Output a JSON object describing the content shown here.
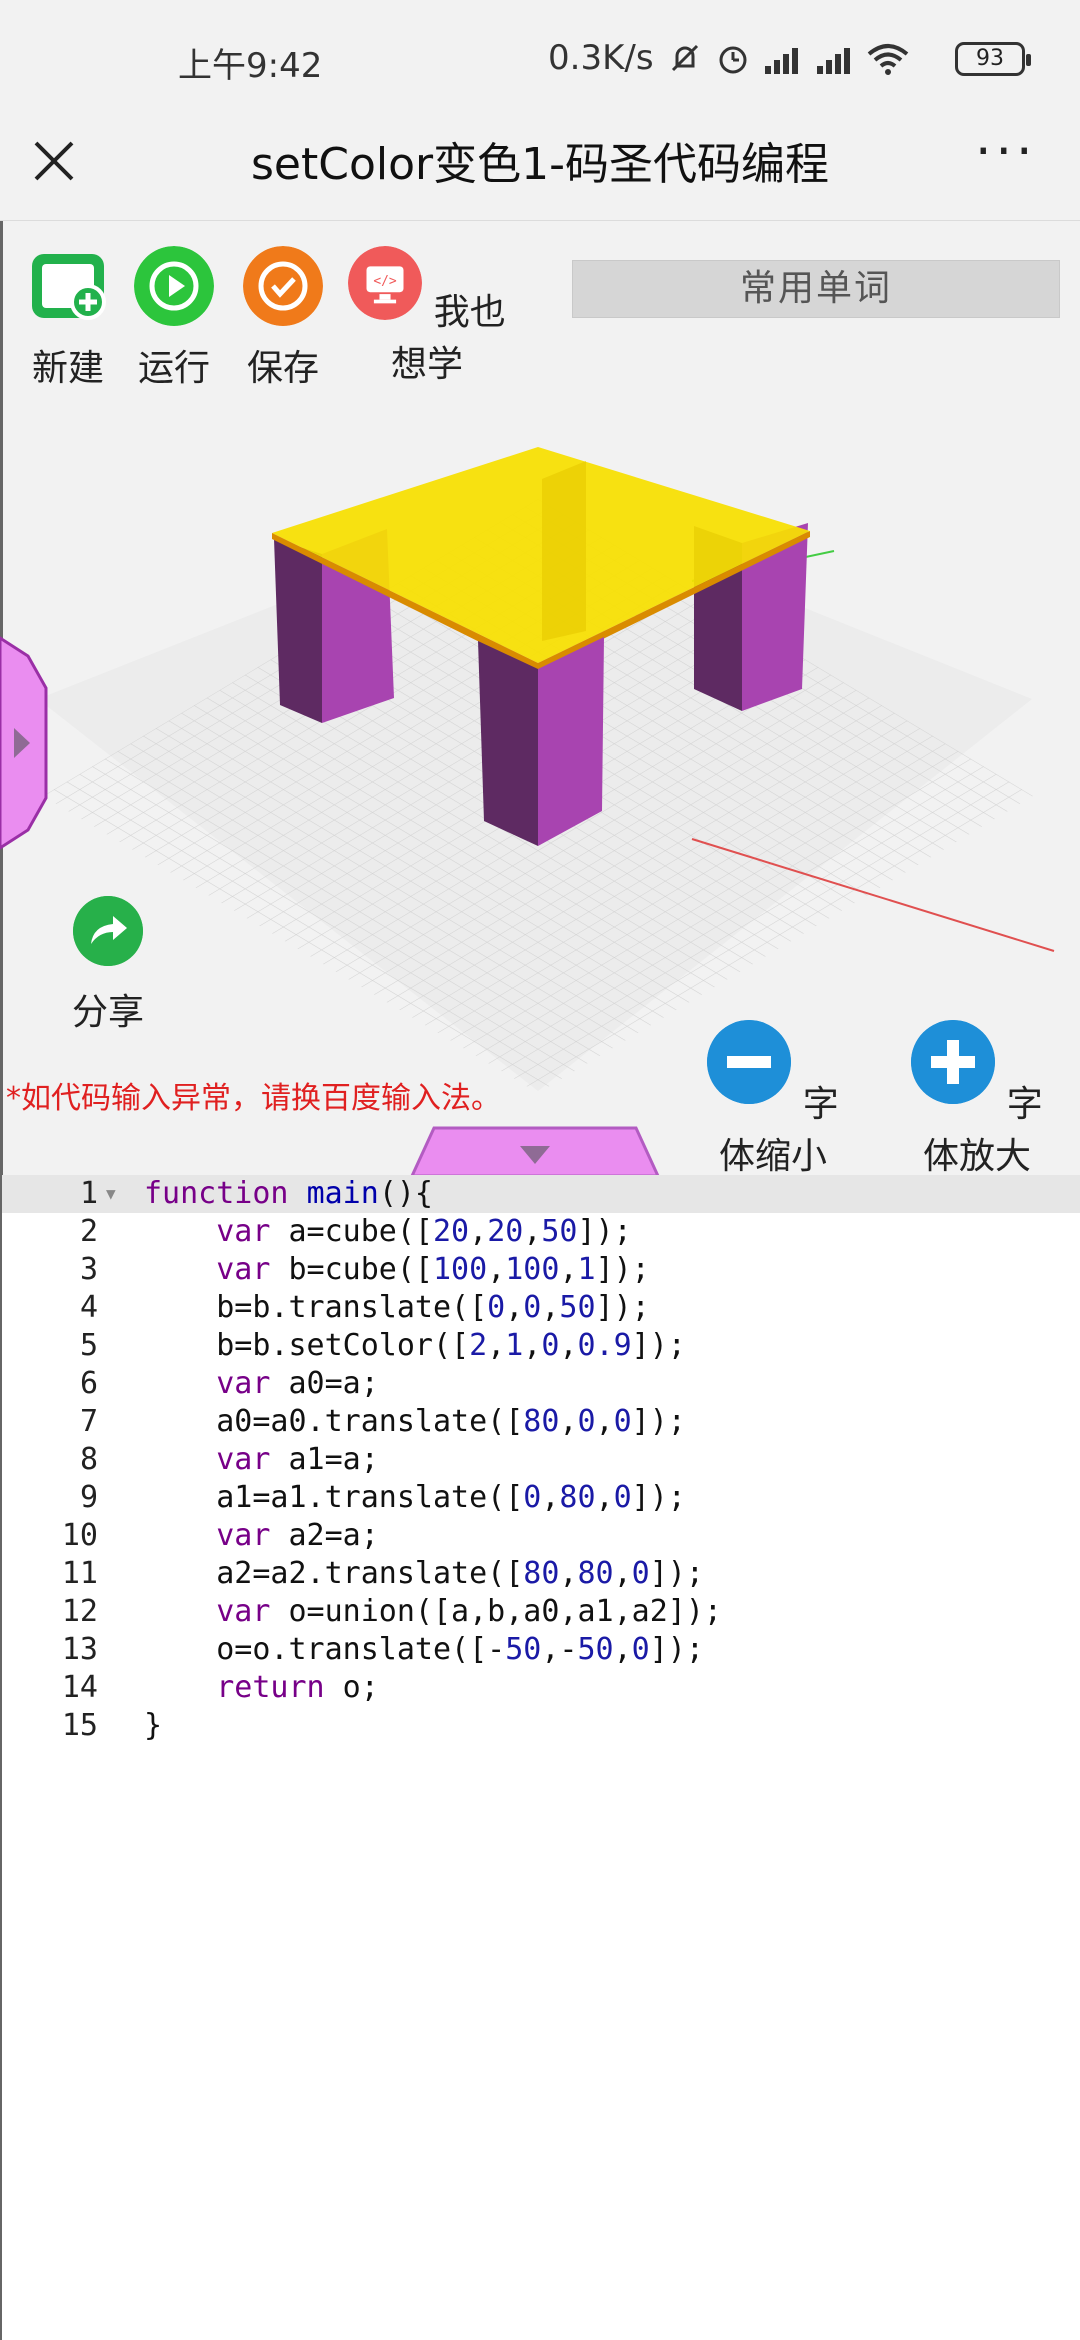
{
  "status_bar": {
    "time": "上午9:42",
    "network_speed": "0.3K/s",
    "battery": "93",
    "icons": [
      "mute-icon",
      "alarm-icon",
      "signal-hd-icon",
      "signal-hd-icon",
      "wifi-icon",
      "battery-icon"
    ]
  },
  "title_bar": {
    "title": "setColor变色1-码圣代码编程"
  },
  "toolbar": {
    "new_label": "新建",
    "run_label": "运行",
    "save_label": "保存",
    "learn_label": "我也想学",
    "common_words_label": "常用单词"
  },
  "side": {
    "share_label": "分享"
  },
  "warning": "*如代码输入异常，请换百度输入法。",
  "font": {
    "decrease_label": "字体缩小",
    "increase_label": "字体放大"
  },
  "colors": {
    "accent_green": "#27b04a",
    "accent_orange": "#f07a1a",
    "accent_blue": "#1e8fd8",
    "panel_pink": "#ea8df0",
    "table_top": "#f7e000",
    "table_legs": "#a844b0"
  },
  "editor": {
    "lines": [
      {
        "n": "1",
        "text": "function main(){"
      },
      {
        "n": "2",
        "text": "var a=cube([20,20,50]);"
      },
      {
        "n": "3",
        "text": "var b=cube([100,100,1]);"
      },
      {
        "n": "4",
        "text": "b=b.translate([0,0,50]);"
      },
      {
        "n": "5",
        "text": "b=b.setColor([2,1,0,0.9]);"
      },
      {
        "n": "6",
        "text": "var a0=a;"
      },
      {
        "n": "7",
        "text": "a0=a0.translate([80,0,0]);"
      },
      {
        "n": "8",
        "text": "var a1=a;"
      },
      {
        "n": "9",
        "text": "a1=a1.translate([0,80,0]);"
      },
      {
        "n": "10",
        "text": "var a2=a;"
      },
      {
        "n": "11",
        "text": "a2=a2.translate([80,80,0]);"
      },
      {
        "n": "12",
        "text": "var o=union([a,b,a0,a1,a2]);"
      },
      {
        "n": "13",
        "text": "o=o.translate([-50,-50,0]);"
      },
      {
        "n": "14",
        "text": "return o;"
      },
      {
        "n": "15",
        "text": "}"
      }
    ]
  }
}
